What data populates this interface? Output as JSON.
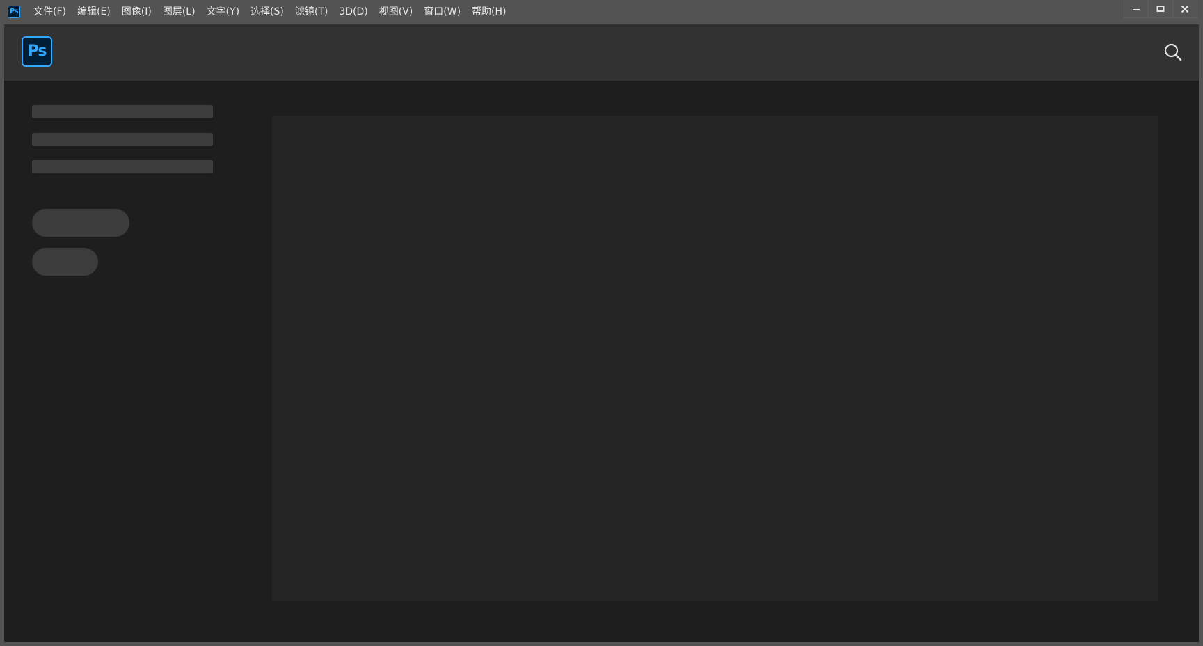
{
  "app": {
    "icon_text": "Ps",
    "logo_text": "Ps"
  },
  "menu": {
    "items": [
      {
        "label": "文件(F)"
      },
      {
        "label": "编辑(E)"
      },
      {
        "label": "图像(I)"
      },
      {
        "label": "图层(L)"
      },
      {
        "label": "文字(Y)"
      },
      {
        "label": "选择(S)"
      },
      {
        "label": "滤镜(T)"
      },
      {
        "label": "3D(D)"
      },
      {
        "label": "视图(V)"
      },
      {
        "label": "窗口(W)"
      },
      {
        "label": "帮助(H)"
      }
    ]
  },
  "window_controls": {
    "minimize_icon": "minimize-icon",
    "maximize_icon": "maximize-icon",
    "close_icon": "close-icon"
  },
  "header": {
    "search_icon": "search-icon"
  },
  "colors": {
    "accent": "#31a8ff",
    "logo_bg": "#001e36",
    "header_bg": "#323232",
    "main_bg": "#1e1e1e",
    "panel_bg": "#252525",
    "skeleton": "#3c3c3c",
    "chrome": "#535353"
  }
}
